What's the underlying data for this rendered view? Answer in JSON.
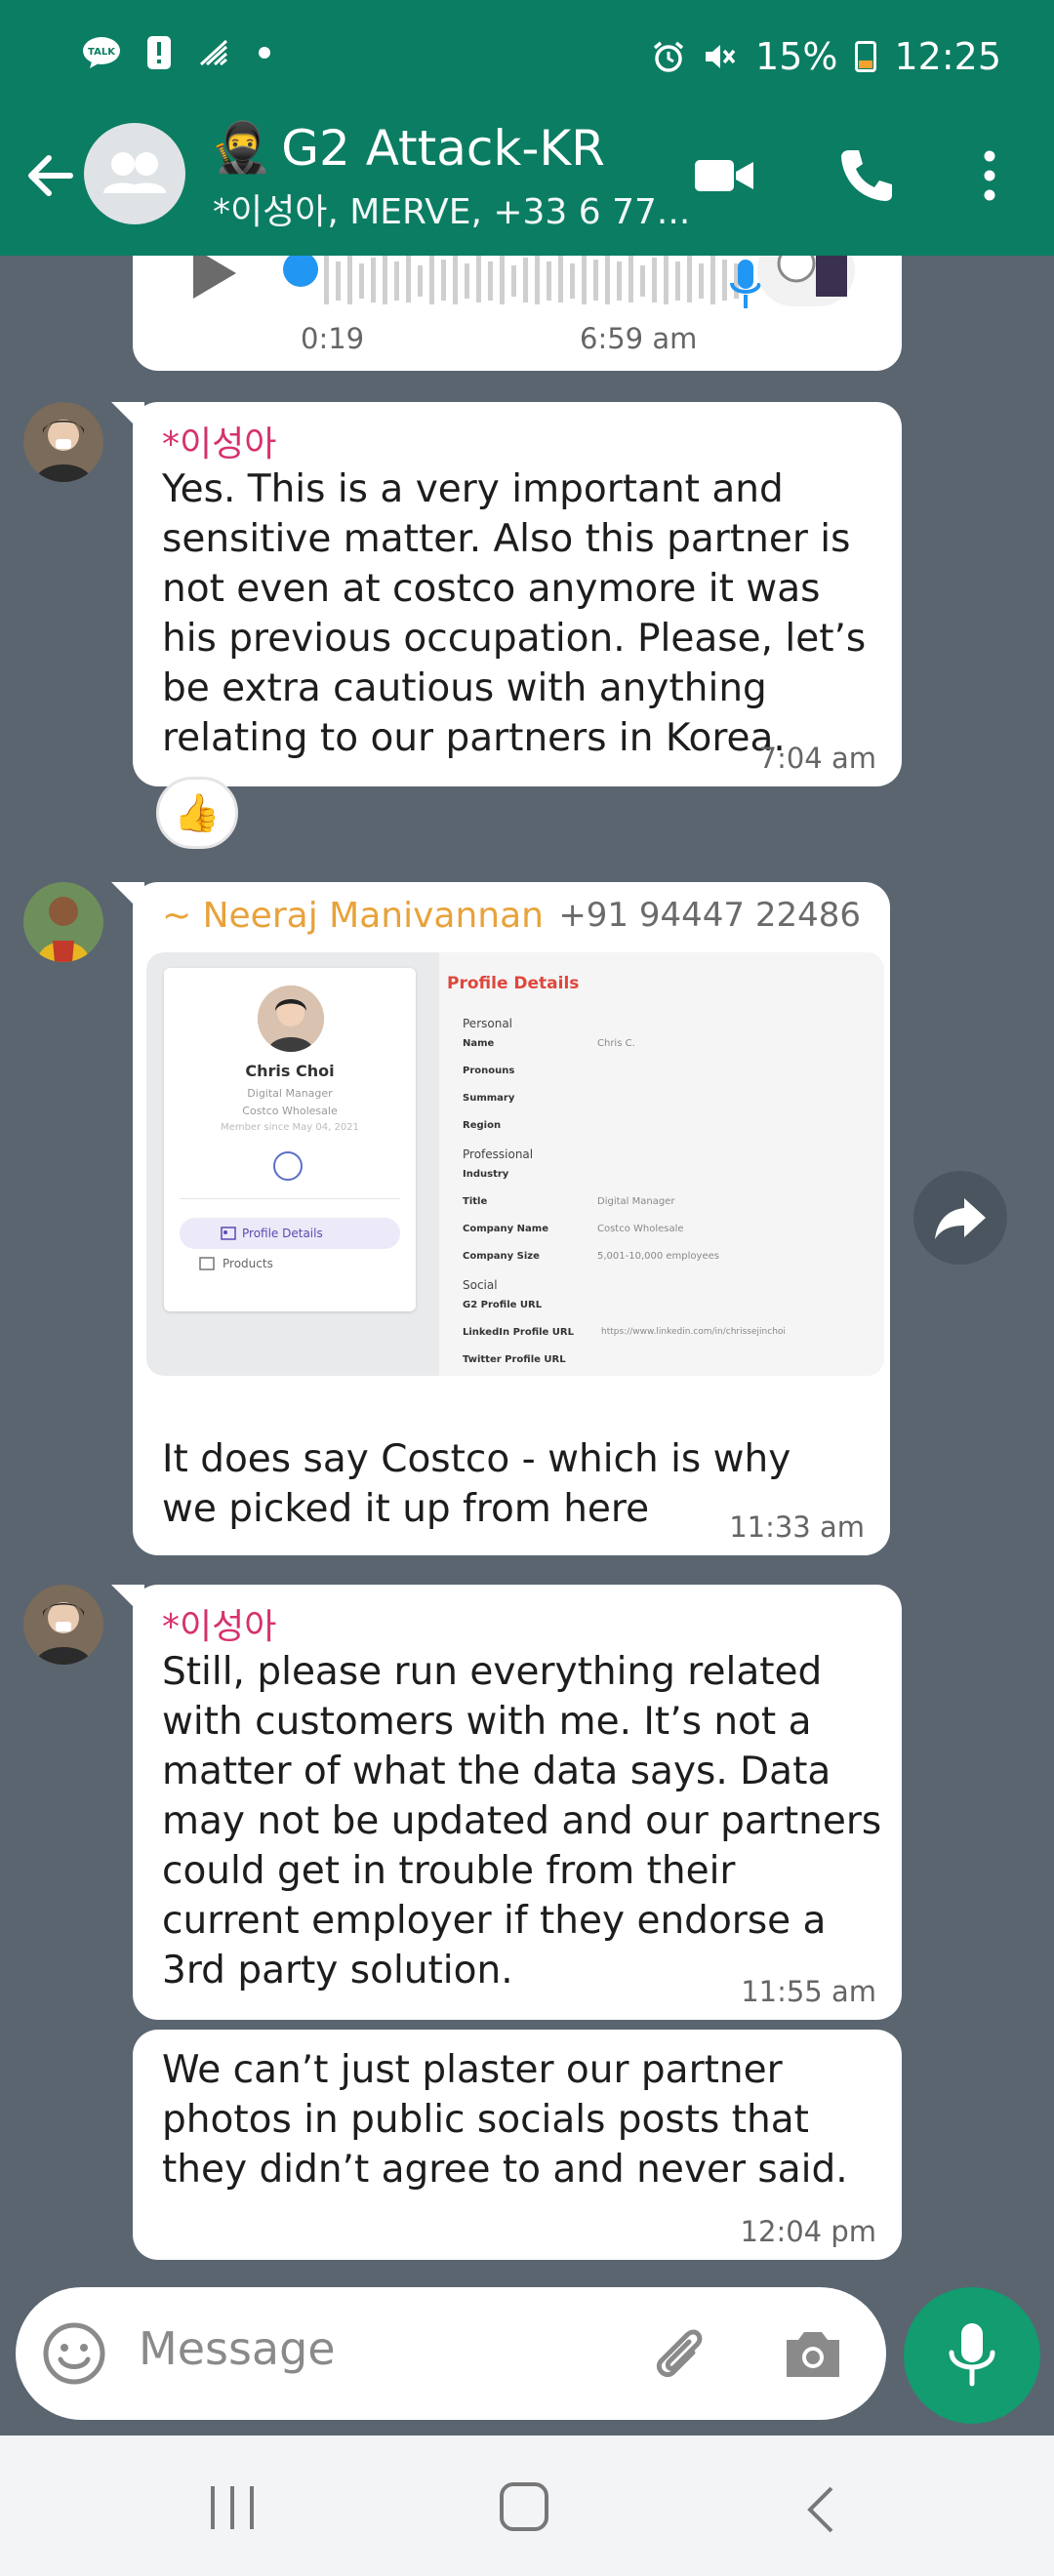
{
  "status_bar": {
    "time": "12:25",
    "battery": "15%",
    "left_icons": [
      "talk-icon",
      "alert-icon",
      "wifi-calling-icon",
      "dot-icon"
    ],
    "right_icons": [
      "alarm-icon",
      "mute-icon",
      "battery-icon"
    ]
  },
  "header": {
    "title": "G2 Attack-KR",
    "title_emoji": "🥷",
    "subtitle": "*이성아, MERVE, +33 6 77..."
  },
  "voice_message": {
    "duration": "0:19",
    "time": "6:59 am"
  },
  "messages": [
    {
      "sender": "*이성아",
      "sender_color": "#d6326e",
      "text": "Yes. This is a very important and sensitive matter. Also this partner is not even at costco anymore it was his previous occupation. Please, let’s be extra cautious with anything relating to our partners in Korea.",
      "time": "7:04 am",
      "reaction": "👍"
    },
    {
      "sender": "~ Neeraj Manivannan",
      "sender_color": "#e8a23a",
      "phone": "+91 94447 22486",
      "text": "It does say Costco - which is why we picked it up from here",
      "time": "11:33 am"
    },
    {
      "sender": "*이성아",
      "sender_color": "#d6326e",
      "text": "Still, please run everything related with customers with me. It’s not a matter of what the data says. Data may not be updated and our partners could get in trouble from their current employer if they endorse a 3rd party solution.",
      "time": "11:55 am"
    },
    {
      "text": "We can’t just plaster our partner photos in public socials posts that they didn’t agree to and never said.",
      "time": "12:04 pm"
    }
  ],
  "profile_card": {
    "name": "Chris Choi",
    "role": "Digital Manager",
    "company": "Costco Wholesale",
    "member_since": "Member since May 04, 2021",
    "tab_active": "Profile Details",
    "tab_other": "Products",
    "heading": "Profile Details",
    "personal_label": "Personal",
    "professional_label": "Professional",
    "social_label": "Social",
    "fields": {
      "name_key": "Name",
      "name_val": "Chris C.",
      "pronouns_key": "Pronouns",
      "summary_key": "Summary",
      "region_key": "Region",
      "industry_key": "Industry",
      "title_key": "Title",
      "title_val": "Digital Manager",
      "company_key": "Company Name",
      "company_val": "Costco Wholesale",
      "size_key": "Company Size",
      "size_val": "5,001-10,000 employees",
      "g2_key": "G2 Profile URL",
      "linkedin_key": "LinkedIn Profile URL",
      "linkedin_val": "https://www.linkedin.com/in/chrissejinchoi",
      "twitter_key": "Twitter Profile URL"
    }
  },
  "composer": {
    "placeholder": "Message"
  },
  "colors": {
    "header": "#0b7d63",
    "chat_background": "#5a6570",
    "fab": "#129c6f"
  }
}
